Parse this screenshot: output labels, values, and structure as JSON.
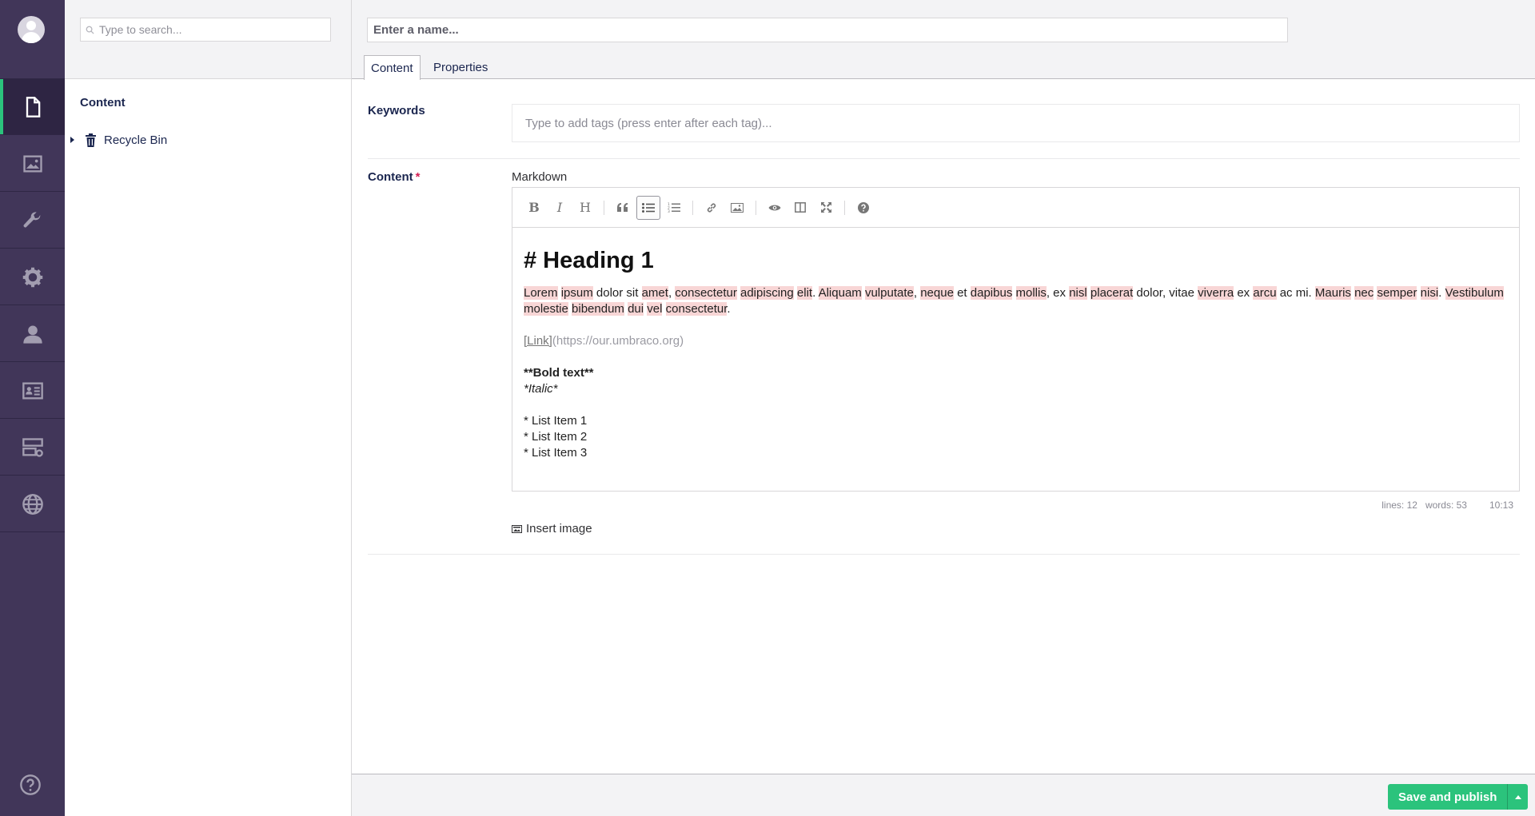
{
  "colors": {
    "nav_bg": "#413659",
    "accent": "#2bc37c",
    "required": "#d42054"
  },
  "tree": {
    "search_placeholder": "Type to search...",
    "title": "Content",
    "nodes": [
      {
        "label": "Recycle Bin",
        "icon": "trash-icon"
      }
    ]
  },
  "appnav": {
    "sections": [
      {
        "name": "content",
        "icon": "document-icon",
        "active": true
      },
      {
        "name": "media",
        "icon": "image-icon",
        "active": false
      },
      {
        "name": "settings",
        "icon": "wrench-icon",
        "active": false
      },
      {
        "name": "packages",
        "icon": "gear-icon",
        "active": false
      },
      {
        "name": "users",
        "icon": "user-icon",
        "active": false
      },
      {
        "name": "members",
        "icon": "id-card-icon",
        "active": false
      },
      {
        "name": "forms",
        "icon": "server-icon",
        "active": false
      },
      {
        "name": "translation",
        "icon": "globe-icon",
        "active": false
      }
    ],
    "help_icon": "help-icon"
  },
  "editor": {
    "name_placeholder": "Enter a name...",
    "tabs": [
      {
        "label": "Content",
        "active": true
      },
      {
        "label": "Properties",
        "active": false
      }
    ],
    "keywords": {
      "label": "Keywords",
      "placeholder": "Type to add tags (press enter after each tag)..."
    },
    "content": {
      "label": "Content",
      "required_mark": "*",
      "editor_title": "Markdown",
      "toolbar": [
        "bold",
        "italic",
        "heading",
        "quote",
        "unordered-list",
        "ordered-list",
        "link",
        "image",
        "preview",
        "side-by-side",
        "fullscreen",
        "guide"
      ],
      "toolbar_active": "unordered-list",
      "heading": "# Heading 1",
      "link_text": "[Link]",
      "link_url": "(https://our.umbraco.org)",
      "bold_line": "**Bold text**",
      "italic_line": "*Italic*",
      "list": [
        "* List Item 1",
        "* List Item 2",
        "* List Item 3"
      ],
      "status": {
        "lines": "lines: 12",
        "words": "words: 53",
        "cursor": "10:13"
      },
      "insert_image": "Insert image"
    }
  },
  "footer": {
    "publish_label": "Save and publish"
  }
}
